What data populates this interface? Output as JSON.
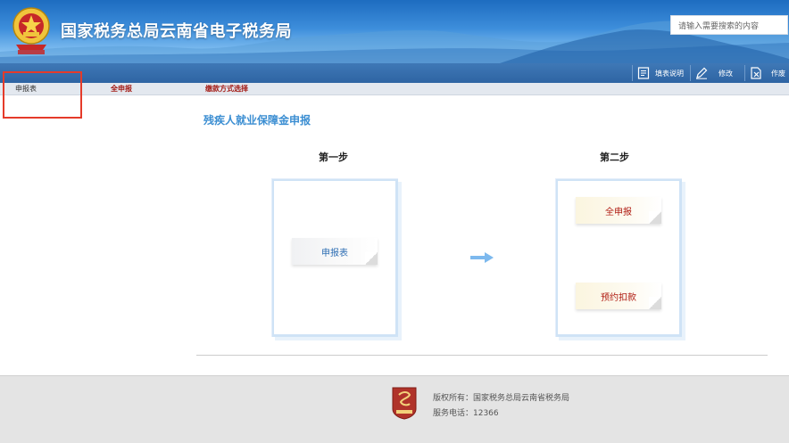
{
  "header": {
    "site_title": "国家税务总局云南省电子税务局",
    "search_placeholder": "请输入需要搜索的内容"
  },
  "toolbar": {
    "items": [
      {
        "label": "填表说明",
        "icon": "document-icon"
      },
      {
        "label": "修改",
        "icon": "pencil-icon"
      },
      {
        "label": "作废",
        "icon": "void-document-icon"
      }
    ]
  },
  "tabs": [
    {
      "label": "申报表"
    },
    {
      "label": "全申报"
    },
    {
      "label": "缴款方式选择"
    }
  ],
  "main": {
    "title": "残疾人就业保障金申报",
    "steps": [
      {
        "title": "第一步",
        "buttons": [
          "申报表"
        ]
      },
      {
        "title": "第二步",
        "buttons": [
          "全申报",
          "预约扣款"
        ]
      }
    ]
  },
  "footer": {
    "copyright": "版权所有：国家税务总局云南省税务局",
    "phone": "服务电话：12366"
  },
  "colors": {
    "banner_blue": "#1d6cc0",
    "toolbar_blue": "#2e64a3",
    "title_blue": "#3b8ed2",
    "tab_red": "#a31a14",
    "highlight_red": "#e53b2a"
  }
}
